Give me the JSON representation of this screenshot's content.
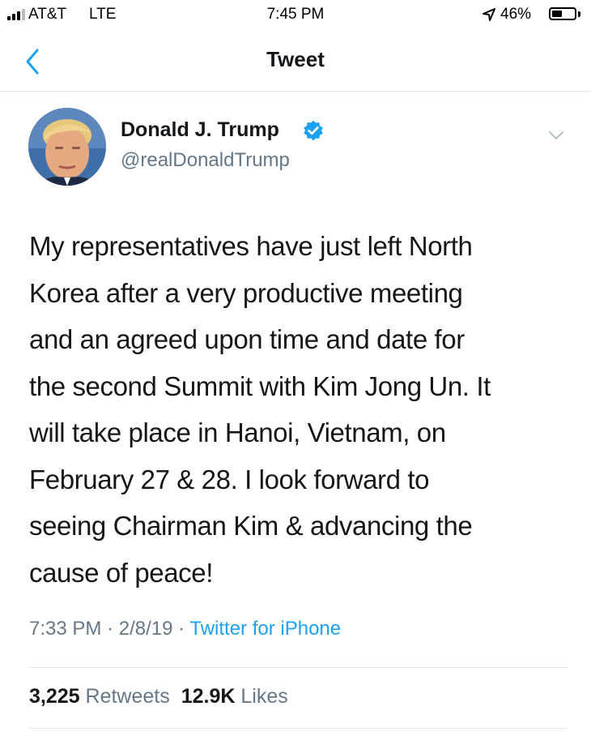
{
  "status_bar": {
    "carrier": "AT&T",
    "network": "LTE",
    "time": "7:45 PM",
    "battery_percent": "46%",
    "battery_level": 0.46,
    "signal_bars": 3
  },
  "nav": {
    "title": "Tweet",
    "back_icon": "chevron-left-icon"
  },
  "tweet": {
    "display_name": "Donald J. Trump",
    "handle": "@realDonaldTrump",
    "verified": true,
    "text_lines": [
      "My representatives have just left North",
      "Korea after a very productive meeting",
      "and an agreed upon time and date for",
      "the second Summit with Kim Jong Un. It",
      "will take place in Hanoi, Vietnam, on",
      "February 27 & 28. I look forward to",
      "seeing Chairman Kim & advancing the",
      "cause of peace!"
    ],
    "time": "7:33 PM",
    "date": "2/8/19",
    "source": "Twitter for iPhone",
    "separator": "·"
  },
  "stats": {
    "retweets_count": "3,225",
    "retweets_label": "Retweets",
    "likes_count": "12.9K",
    "likes_label": "Likes"
  },
  "colors": {
    "accent": "#1da1f2",
    "secondary_text": "#657786",
    "primary_text": "#14171a",
    "divider": "#e1e8ed"
  }
}
